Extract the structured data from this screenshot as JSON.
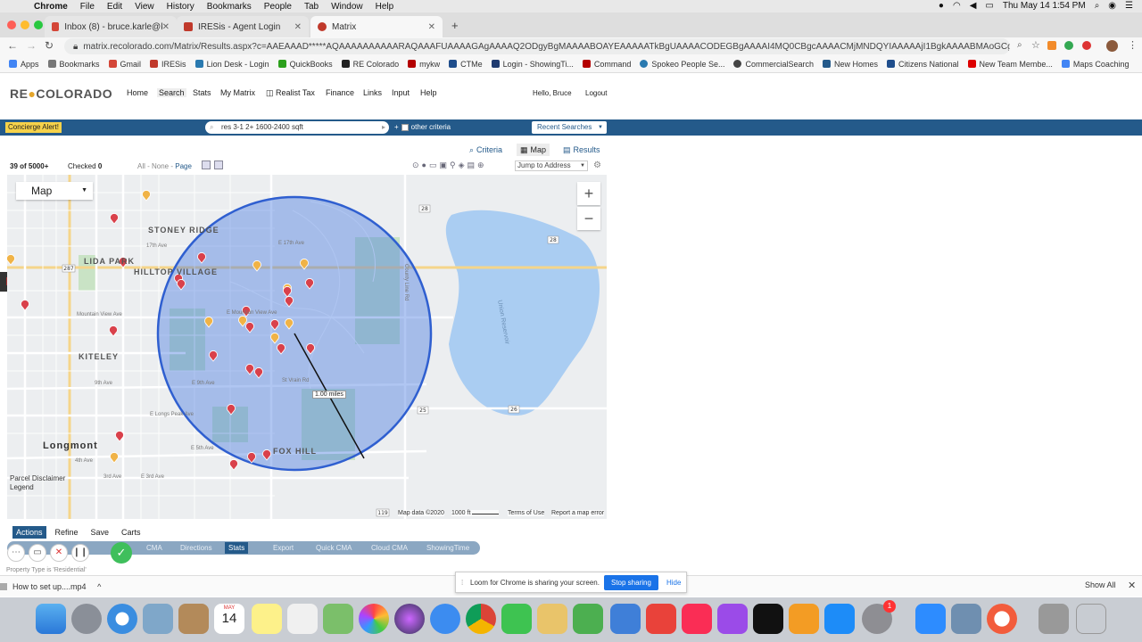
{
  "macos": {
    "menu": [
      "Chrome",
      "File",
      "Edit",
      "View",
      "History",
      "Bookmarks",
      "People",
      "Tab",
      "Window",
      "Help"
    ],
    "clock": "Thu May 14  1:54 PM"
  },
  "browser": {
    "tabs": [
      {
        "title": "Inbox (8) - bruce.karle@kw.co",
        "active": false,
        "fav": "#d44638"
      },
      {
        "title": "IRESis - Agent Login",
        "active": false,
        "fav": "#c0392b"
      },
      {
        "title": "Matrix",
        "active": true,
        "fav": "#c0392b"
      }
    ],
    "url": "matrix.recolorado.com/Matrix/Results.aspx?c=AAEAAAD*****AQAAAAAAAAAARAQAAAFUAAAAGAgAAAAQ2ODgyBgMAAAABOAYEAAAAATkBgUAAAACODEGBgAAAAI4MQ0CBgcAAAACMjMNDQYIAAAAAjI1BgkAAAABMAoGCgAAAEwDS0GCwAAA...",
    "bookmarks": [
      {
        "label": "Apps",
        "color": "#4285f4"
      },
      {
        "label": "Bookmarks",
        "color": "#777"
      },
      {
        "label": "Gmail",
        "color": "#d44638"
      },
      {
        "label": "IRESis",
        "color": "#c0392b"
      },
      {
        "label": "Lion Desk - Login",
        "color": "#2a7ab0"
      },
      {
        "label": "QuickBooks",
        "color": "#2ca01c"
      },
      {
        "label": "RE Colorado",
        "color": "#222"
      },
      {
        "label": "mykw",
        "color": "#b40000"
      },
      {
        "label": "CTMe",
        "color": "#1f4e8c"
      },
      {
        "label": "Login - ShowingTi...",
        "color": "#1f3b70"
      },
      {
        "label": "Command",
        "color": "#b40000"
      },
      {
        "label": "Spokeo People Se...",
        "color": "#2a7ab0"
      },
      {
        "label": "CommercialSearch",
        "color": "#444"
      },
      {
        "label": "New Homes",
        "color": "#245a8a"
      },
      {
        "label": "Citizens National",
        "color": "#1f4e8c"
      },
      {
        "label": "New Team Membe...",
        "color": "#d00"
      },
      {
        "label": "Maps Coaching",
        "color": "#4285f4"
      }
    ]
  },
  "app": {
    "logo_left": "RE",
    "logo_o": "●",
    "logo_right": "COLORADO",
    "nav": [
      "Home",
      "Search",
      "Stats",
      "My Matrix",
      "Realist Tax",
      "Finance",
      "Links",
      "Input",
      "Help"
    ],
    "user": "Hello, Bruce",
    "logout": "Logout",
    "concierge": "Concierge Alert!",
    "quick_search": "res 3-1 2+ 1600-2400 sqft",
    "other_criteria": "other criteria",
    "recent_searches": "Recent Searches",
    "view_tabs": [
      "Criteria",
      "Map",
      "Results"
    ],
    "count": "39 of 5000+",
    "checked_label": "Checked",
    "checked_value": "0",
    "select_all": "All",
    "select_none": "None",
    "select_page": "Page",
    "jump": "Jump to Address"
  },
  "map": {
    "label": "Map",
    "zoom_in": "+",
    "zoom_out": "−",
    "radius_label": "1.00 miles",
    "places": [
      "STONEY RIDGE",
      "LIDA PARK",
      "HILLTOP VILLAGE",
      "KITELEY",
      "Longmont",
      "FOX HILL"
    ],
    "streets": [
      "E 17th Ave",
      "17th Ave",
      "E Mountain View Ave",
      "Mountain View Ave",
      "9th Ave",
      "E 9th Ave",
      "St Vrain Rd",
      "E Longs Peak Ave",
      "E 5th Ave",
      "4th Ave",
      "3rd Ave",
      "E 3rd Ave",
      "Union Reservoir",
      "County Line Rd"
    ],
    "shields": [
      "28",
      "28",
      "25",
      "26",
      "287",
      "119"
    ],
    "legend": [
      "Parcel",
      "Legend"
    ],
    "disclaimer": "Disclaimer",
    "footer": {
      "data": "Map data ©2020",
      "scale": "1000 ft",
      "terms": "Terms of Use",
      "report": "Report a map error"
    }
  },
  "actions": {
    "tabs": [
      "Actions",
      "Refine",
      "Save",
      "Carts"
    ],
    "tools": [
      "CMA",
      "Directions",
      "Stats",
      "Export",
      "Quick CMA",
      "Cloud CMA",
      "ShowingTime"
    ]
  },
  "property_type": "Property Type is 'Residential'",
  "download": {
    "file": "How to set up....mp4",
    "show_all": "Show All"
  },
  "loom": {
    "text": "Loom for Chrome is sharing your screen.",
    "stop": "Stop sharing",
    "hide": "Hide"
  },
  "dock": {
    "calendar_month": "MAY",
    "calendar_day": "14",
    "badge": "1"
  }
}
